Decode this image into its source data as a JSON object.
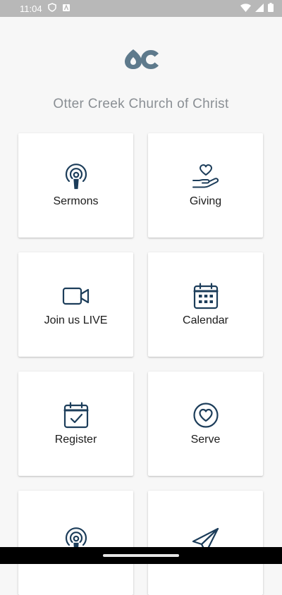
{
  "status_bar": {
    "time": "11:04"
  },
  "app": {
    "church_name": "Otter Creek Church of Christ"
  },
  "tiles": [
    {
      "label": "Sermons",
      "icon": "podcast-icon"
    },
    {
      "label": "Giving",
      "icon": "heart-hand-icon"
    },
    {
      "label": "Join us LIVE",
      "icon": "video-camera-icon"
    },
    {
      "label": "Calendar",
      "icon": "calendar-icon"
    },
    {
      "label": "Register",
      "icon": "calendar-check-icon"
    },
    {
      "label": "Serve",
      "icon": "heart-circle-icon"
    },
    {
      "label": "",
      "icon": "podcast-icon"
    },
    {
      "label": "",
      "icon": "paper-plane-icon"
    }
  ],
  "colors": {
    "icon": "#1c3d5a",
    "logo": "#5e7a8c",
    "status_bar": "#b8b8b8"
  }
}
